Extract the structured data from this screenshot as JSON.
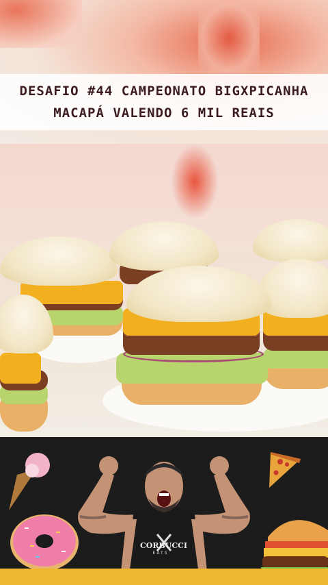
{
  "caption": {
    "line1": "DESAFIO #44 CAMPEONATO BIGXPICANHA",
    "line2": "MACAPÁ VALENDO 6 MIL REAIS"
  },
  "banner": {
    "brand_main": "CORBUCCI",
    "brand_sub": "EATS"
  },
  "colors": {
    "banner_bg": "#1c1c1c",
    "banner_stripe": "#f0b731",
    "caption_text": "#3a1c22"
  },
  "icons": [
    "ice-cream-icon",
    "pizza-slice-icon",
    "donut-icon",
    "burger-icon"
  ]
}
